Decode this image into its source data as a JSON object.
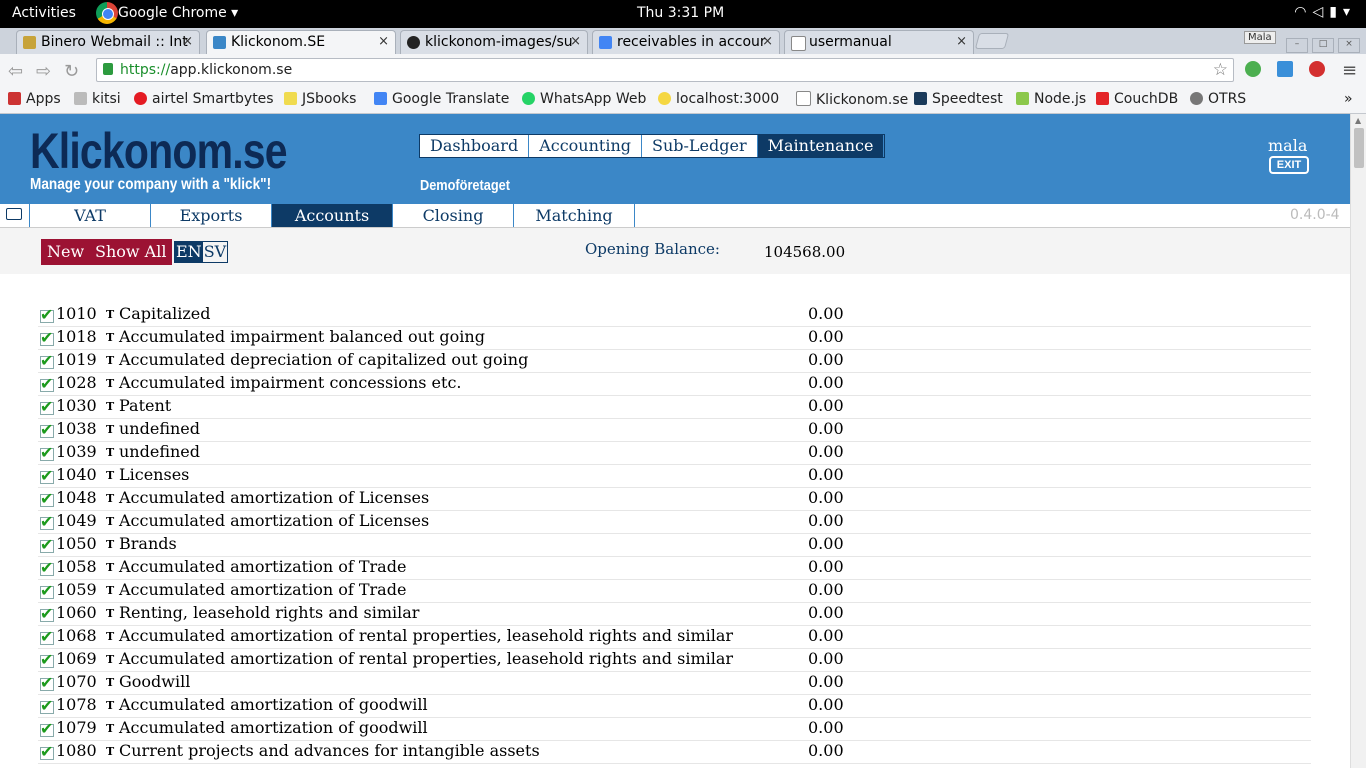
{
  "gnome": {
    "activities": "Activities",
    "app": "Google Chrome ▾",
    "clock": "Thu  3:31 PM"
  },
  "tabs": [
    {
      "label": "Binero Webmail :: Int",
      "close": "×"
    },
    {
      "label": "Klickonom.SE",
      "close": "×"
    },
    {
      "label": "klickonom-images/su",
      "close": "×"
    },
    {
      "label": "receivables in accour",
      "close": "×"
    },
    {
      "label": "usermanual",
      "close": "×"
    }
  ],
  "profile_chip": "Mala",
  "address": {
    "scheme": "https://",
    "host": "app.klickonom.se"
  },
  "bookmarks": [
    "Apps",
    "kitsi",
    "airtel Smartbytes",
    "JSbooks",
    "Google Translate",
    "WhatsApp Web",
    "localhost:3000",
    "Klickonom.se",
    "Speedtest",
    "Node.js",
    "CouchDB",
    "OTRS"
  ],
  "bookmarks_more": "»",
  "app": {
    "logo": "Klickonom.se",
    "tagline": "Manage your company with a \"klick\"!",
    "company": "Demoföretaget",
    "user": "mala",
    "exit": "EXIT",
    "version": "0.4.0-4",
    "main_nav": [
      "Dashboard",
      "Accounting",
      "Sub-Ledger",
      "Maintenance"
    ],
    "main_nav_selected": "Maintenance",
    "sub_nav": [
      "VAT",
      "Exports",
      "Accounts",
      "Closing",
      "Matching"
    ],
    "sub_nav_selected": "Accounts"
  },
  "actions": {
    "new": "New",
    "show_all": "Show All",
    "lang_en": "EN",
    "lang_sv": "SV"
  },
  "opening_balance": {
    "label": "Opening Balance:",
    "value": "104568.00"
  },
  "accounts": [
    {
      "number": "1010",
      "type": "T",
      "name": "Capitalized",
      "balance": "0.00"
    },
    {
      "number": "1018",
      "type": "T",
      "name": "Accumulated impairment balanced out going",
      "balance": "0.00"
    },
    {
      "number": "1019",
      "type": "T",
      "name": "Accumulated depreciation of capitalized out going",
      "balance": "0.00"
    },
    {
      "number": "1028",
      "type": "T",
      "name": "Accumulated impairment concessions etc.",
      "balance": "0.00"
    },
    {
      "number": "1030",
      "type": "T",
      "name": "Patent",
      "balance": "0.00"
    },
    {
      "number": "1038",
      "type": "T",
      "name": "undefined",
      "balance": "0.00"
    },
    {
      "number": "1039",
      "type": "T",
      "name": "undefined",
      "balance": "0.00"
    },
    {
      "number": "1040",
      "type": "T",
      "name": "Licenses",
      "balance": "0.00"
    },
    {
      "number": "1048",
      "type": "T",
      "name": "Accumulated amortization of Licenses",
      "balance": "0.00"
    },
    {
      "number": "1049",
      "type": "T",
      "name": "Accumulated amortization of Licenses",
      "balance": "0.00"
    },
    {
      "number": "1050",
      "type": "T",
      "name": "Brands",
      "balance": "0.00"
    },
    {
      "number": "1058",
      "type": "T",
      "name": "Accumulated amortization of Trade",
      "balance": "0.00"
    },
    {
      "number": "1059",
      "type": "T",
      "name": "Accumulated amortization of Trade",
      "balance": "0.00"
    },
    {
      "number": "1060",
      "type": "T",
      "name": "Renting, leasehold rights and similar",
      "balance": "0.00"
    },
    {
      "number": "1068",
      "type": "T",
      "name": "Accumulated amortization of rental properties, leasehold rights and similar",
      "balance": "0.00"
    },
    {
      "number": "1069",
      "type": "T",
      "name": "Accumulated amortization of rental properties, leasehold rights and similar",
      "balance": "0.00"
    },
    {
      "number": "1070",
      "type": "T",
      "name": "Goodwill",
      "balance": "0.00"
    },
    {
      "number": "1078",
      "type": "T",
      "name": "Accumulated amortization of goodwill",
      "balance": "0.00"
    },
    {
      "number": "1079",
      "type": "T",
      "name": "Accumulated amortization of goodwill",
      "balance": "0.00"
    },
    {
      "number": "1080",
      "type": "T",
      "name": "Current projects and advances for intangible assets",
      "balance": "0.00"
    }
  ],
  "colors": {
    "header_bg": "#3b87c7",
    "navy": "#0d3a66",
    "button_red": "#9c1233",
    "check_green": "#1c9a1c"
  }
}
